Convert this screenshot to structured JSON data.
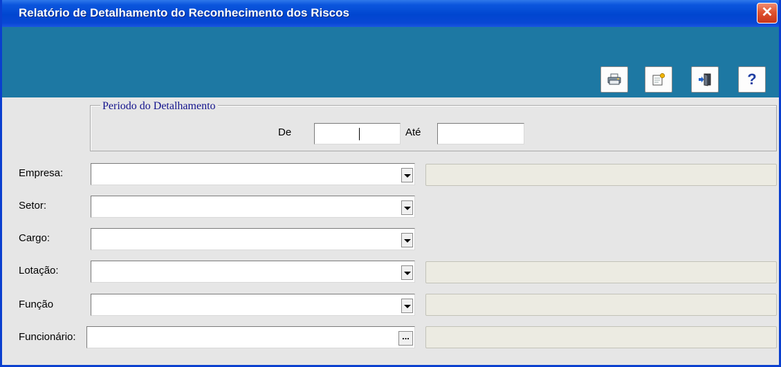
{
  "window": {
    "title": "Relatório de Detalhamento do Reconhecimento dos Riscos",
    "close_label": "✕"
  },
  "toolbar": {
    "buttons": [
      {
        "name": "print",
        "icon": "printer-icon"
      },
      {
        "name": "edit",
        "icon": "edit-note-icon"
      },
      {
        "name": "exit",
        "icon": "exit-door-icon"
      },
      {
        "name": "help",
        "icon": "help-icon",
        "label": "?"
      }
    ]
  },
  "period": {
    "legend": "Periodo do Detalhamento",
    "from_label": "De",
    "from_value": "",
    "to_label": "Até",
    "to_value": ""
  },
  "fields": {
    "empresa": {
      "label": "Empresa:",
      "value": "",
      "description": ""
    },
    "setor": {
      "label": "Setor:",
      "value": ""
    },
    "cargo": {
      "label": "Cargo:",
      "value": ""
    },
    "lotacao": {
      "label": "Lotação:",
      "value": "",
      "description": ""
    },
    "funcao": {
      "label": "Função",
      "value": "",
      "description": ""
    },
    "funcionario": {
      "label": "Funcionário:",
      "value": "",
      "description": "",
      "lookup_label": "..."
    }
  },
  "colors": {
    "titlebar": "#0046d0",
    "toolbar": "#1d78a3",
    "body": "#e6e6e6",
    "legend_text": "#12128c",
    "readonly_field": "#ecebe2"
  }
}
